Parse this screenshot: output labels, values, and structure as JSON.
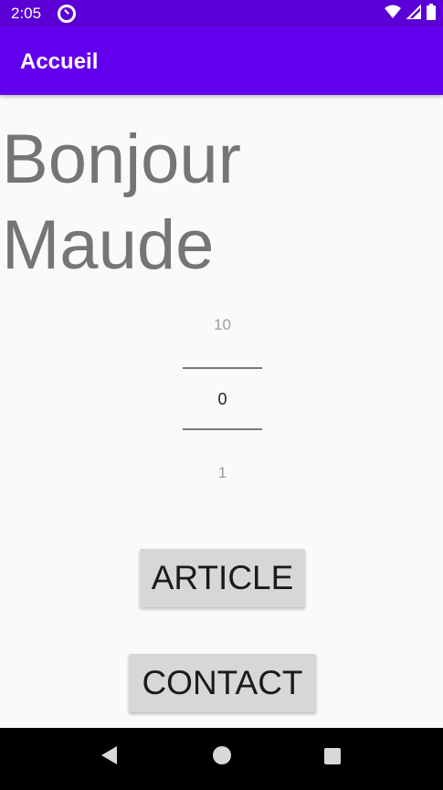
{
  "status_bar": {
    "time": "2:05",
    "icons": [
      "app-notification-icon",
      "wifi-icon",
      "cellular-signal-icon",
      "battery-icon"
    ]
  },
  "app_bar": {
    "title": "Accueil",
    "color": "#6200ee"
  },
  "greeting": "Bonjour Maude",
  "number_picker": {
    "previous": "10",
    "current": "0",
    "next": "1"
  },
  "buttons": {
    "article_label": "ARTICLE",
    "contact_label": "CONTACT"
  },
  "nav_bar": {
    "icons": [
      "back-icon",
      "home-icon",
      "recents-icon"
    ]
  }
}
